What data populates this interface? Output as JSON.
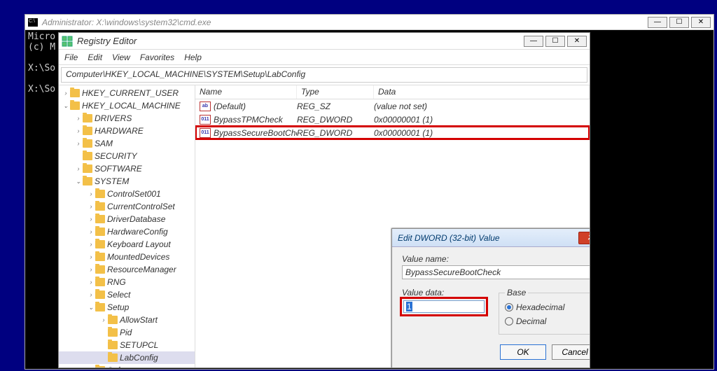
{
  "cmd": {
    "title": "Administrator: X:\\windows\\system32\\cmd.exe",
    "lines": "Micro\n(c) M\n\nX:\\So\n\nX:\\So"
  },
  "regedit": {
    "title": "Registry Editor",
    "menu": [
      "File",
      "Edit",
      "View",
      "Favorites",
      "Help"
    ],
    "path": "Computer\\HKEY_LOCAL_MACHINE\\SYSTEM\\Setup\\LabConfig",
    "tree": [
      {
        "indent": 0,
        "chev": ">",
        "label": "HKEY_CURRENT_USER"
      },
      {
        "indent": 0,
        "chev": "v",
        "label": "HKEY_LOCAL_MACHINE"
      },
      {
        "indent": 1,
        "chev": ">",
        "label": "DRIVERS"
      },
      {
        "indent": 1,
        "chev": ">",
        "label": "HARDWARE"
      },
      {
        "indent": 1,
        "chev": ">",
        "label": "SAM"
      },
      {
        "indent": 1,
        "chev": "",
        "label": "SECURITY"
      },
      {
        "indent": 1,
        "chev": ">",
        "label": "SOFTWARE"
      },
      {
        "indent": 1,
        "chev": "v",
        "label": "SYSTEM"
      },
      {
        "indent": 2,
        "chev": ">",
        "label": "ControlSet001"
      },
      {
        "indent": 2,
        "chev": ">",
        "label": "CurrentControlSet"
      },
      {
        "indent": 2,
        "chev": ">",
        "label": "DriverDatabase"
      },
      {
        "indent": 2,
        "chev": ">",
        "label": "HardwareConfig"
      },
      {
        "indent": 2,
        "chev": ">",
        "label": "Keyboard Layout"
      },
      {
        "indent": 2,
        "chev": ">",
        "label": "MountedDevices"
      },
      {
        "indent": 2,
        "chev": ">",
        "label": "ResourceManager"
      },
      {
        "indent": 2,
        "chev": ">",
        "label": "RNG"
      },
      {
        "indent": 2,
        "chev": ">",
        "label": "Select"
      },
      {
        "indent": 2,
        "chev": "v",
        "label": "Setup"
      },
      {
        "indent": 3,
        "chev": ">",
        "label": "AllowStart"
      },
      {
        "indent": 3,
        "chev": "",
        "label": "Pid"
      },
      {
        "indent": 3,
        "chev": "",
        "label": "SETUPCL"
      },
      {
        "indent": 3,
        "chev": "",
        "label": "LabConfig",
        "selected": true
      },
      {
        "indent": 2,
        "chev": ">",
        "label": "Software"
      }
    ],
    "columns": {
      "name": "Name",
      "type": "Type",
      "data": "Data"
    },
    "values": [
      {
        "icon": "ab",
        "name": "(Default)",
        "type": "REG_SZ",
        "data": "(value not set)"
      },
      {
        "icon": "01",
        "name": "BypassTPMCheck",
        "type": "REG_DWORD",
        "data": "0x00000001 (1)"
      },
      {
        "icon": "01",
        "name": "BypassSecureBootCheck",
        "type": "REG_DWORD",
        "data": "0x00000001 (1)",
        "highlight": true
      }
    ]
  },
  "dialog": {
    "title": "Edit DWORD (32-bit) Value",
    "valueNameLabel": "Value name:",
    "valueName": "BypassSecureBootCheck",
    "valueDataLabel": "Value data:",
    "valueData": "1",
    "baseLabel": "Base",
    "hexLabel": "Hexadecimal",
    "decLabel": "Decimal",
    "baseSelected": "hex",
    "okLabel": "OK",
    "cancelLabel": "Cancel"
  }
}
